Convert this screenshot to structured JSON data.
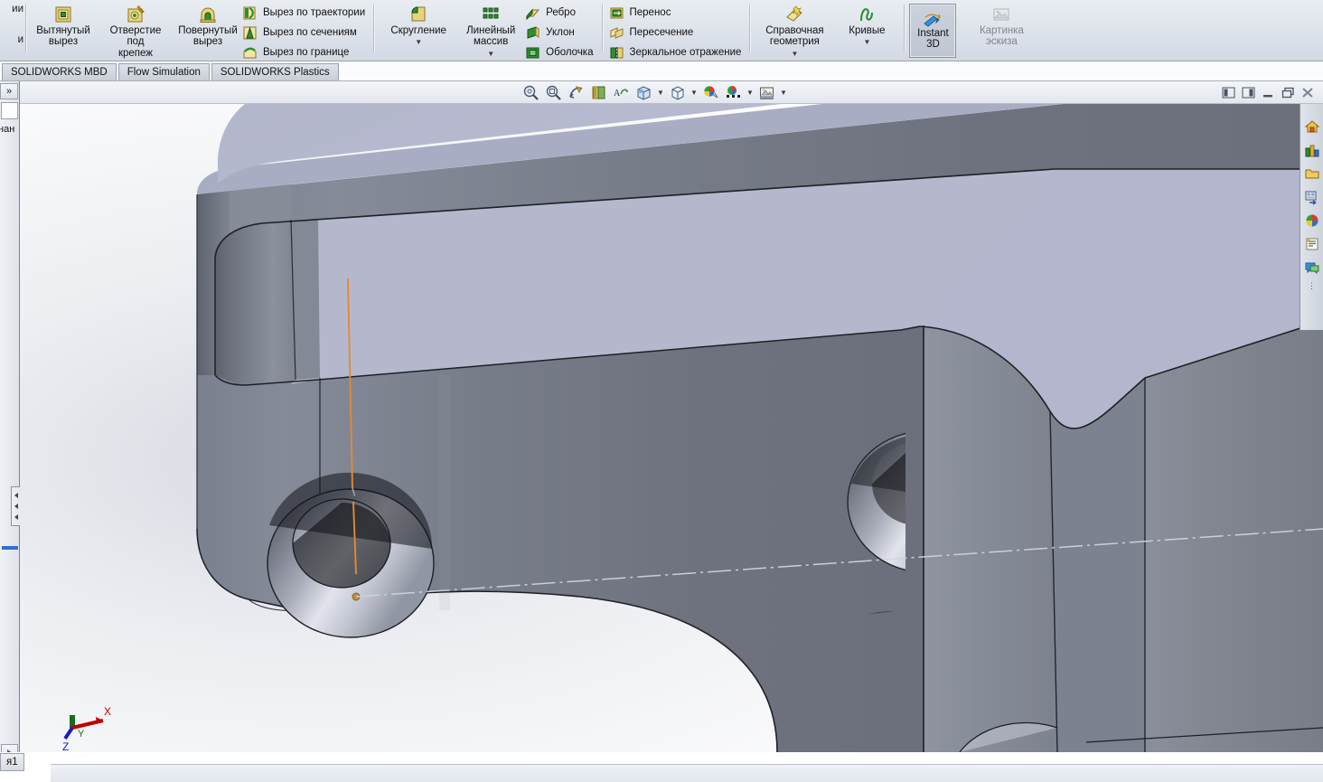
{
  "ribbon": {
    "truncated_left_group": {
      "line1": "ии",
      "line2": "и"
    },
    "features_group": [
      {
        "label": "Вытянутый\nвырез",
        "icon": "extruded-cut-icon",
        "has_caret": false
      },
      {
        "label": "Отверстие\nпод\nкрепеж",
        "icon": "hole-wizard-icon",
        "has_caret": false
      },
      {
        "label": "Повернутый\nвырез",
        "icon": "revolved-cut-icon",
        "has_caret": false
      }
    ],
    "cut_small_items": [
      {
        "label": "Вырез по траектории",
        "icon": "swept-cut-icon"
      },
      {
        "label": "Вырез по сечениям",
        "icon": "lofted-cut-icon"
      },
      {
        "label": "Вырез по границе",
        "icon": "boundary-cut-icon"
      }
    ],
    "modify_group": [
      {
        "label": "Скругление",
        "icon": "fillet-icon",
        "has_caret": true
      },
      {
        "label": "Линейный\nмассив",
        "icon": "linear-pattern-icon",
        "has_caret": true
      }
    ],
    "modify_small_items": [
      {
        "label": "Ребро",
        "icon": "rib-icon"
      },
      {
        "label": "Уклон",
        "icon": "draft-icon"
      },
      {
        "label": "Оболочка",
        "icon": "shell-icon"
      }
    ],
    "transform_small_items": [
      {
        "label": "Перенос",
        "icon": "move-face-icon"
      },
      {
        "label": "Пересечение",
        "icon": "intersect-icon"
      },
      {
        "label": "Зеркальное отражение",
        "icon": "mirror-icon"
      }
    ],
    "reference_group": [
      {
        "label": "Справочная\nгеометрия",
        "icon": "reference-geometry-icon",
        "has_caret": true
      },
      {
        "label": "Кривые",
        "icon": "curves-icon",
        "has_caret": true
      }
    ],
    "instant3d": {
      "label": "Instant\n3D",
      "icon": "instant3d-icon",
      "active": true
    },
    "sketch_picture": {
      "label": "Картинка\nэскиза",
      "icon": "sketch-picture-icon",
      "disabled": true
    }
  },
  "tabs": [
    {
      "label": "SOLIDWORKS MBD"
    },
    {
      "label": "Flow Simulation"
    },
    {
      "label": "SOLIDWORKS Plastics"
    }
  ],
  "view_toolbar": [
    {
      "name": "zoom-to-fit-icon",
      "caret": false
    },
    {
      "name": "zoom-to-area-icon",
      "caret": false
    },
    {
      "name": "previous-view-icon",
      "caret": false
    },
    {
      "name": "section-view-icon",
      "caret": false
    },
    {
      "name": "view-orientation-icon",
      "caret": false
    },
    {
      "name": "display-style-icon",
      "caret": true
    },
    {
      "name": "hide-show-items-icon",
      "caret": true
    },
    {
      "name": "edit-appearance-icon",
      "caret": true
    },
    {
      "name": "apply-scene-icon",
      "caret": true
    },
    {
      "name": "view-settings-icon",
      "caret": true
    }
  ],
  "window_buttons": [
    {
      "name": "tile-left-icon"
    },
    {
      "name": "tile-right-icon"
    },
    {
      "name": "minimize-icon"
    },
    {
      "name": "restore-icon"
    },
    {
      "name": "close-icon"
    }
  ],
  "left_panel": {
    "expander": "»",
    "truncated_label": "нан"
  },
  "task_pane": [
    {
      "name": "solidworks-resources-icon"
    },
    {
      "name": "design-library-icon"
    },
    {
      "name": "file-explorer-icon"
    },
    {
      "name": "view-palette-icon"
    },
    {
      "name": "appearances-scenes-icon"
    },
    {
      "name": "custom-properties-icon"
    },
    {
      "name": "solidworks-forum-icon"
    }
  ],
  "document_tab": {
    "label": "я1"
  },
  "model": {
    "colors": {
      "top_face": "#b4b7cd",
      "front_face": "#70747f",
      "side_face": "#7f8491",
      "mid_face": "#888d99",
      "hole_bright": "#d3d6e0",
      "hole_dark": "#44474f",
      "edge": "#1d1f24",
      "axis": "#e08a34",
      "background_top": "#fefefe",
      "background_haze": "#d9dde3"
    },
    "triad": {
      "x_label": "X",
      "x_color": "#c00000",
      "y_label": "Y",
      "y_color": "#1a6b1a",
      "z_label": "Z",
      "z_color": "#1a1acc"
    }
  }
}
